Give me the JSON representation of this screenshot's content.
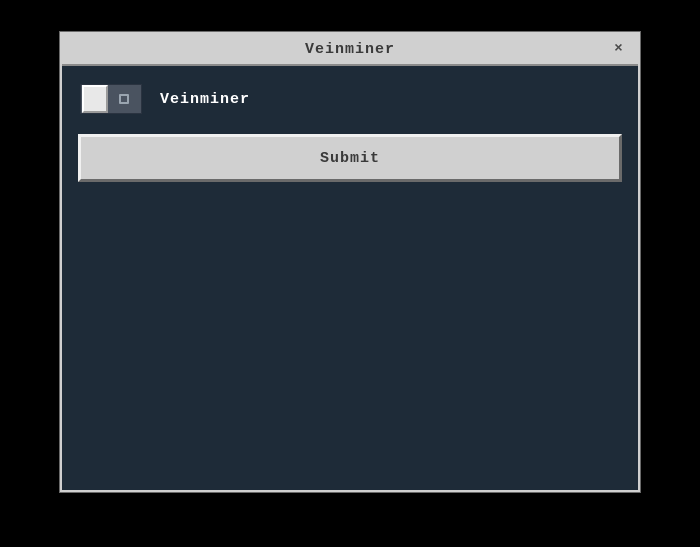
{
  "dialog": {
    "title": "Veinminer",
    "close_label": "×"
  },
  "toggle": {
    "label": "Veinminer",
    "state": "off"
  },
  "submit": {
    "label": "Submit"
  }
}
